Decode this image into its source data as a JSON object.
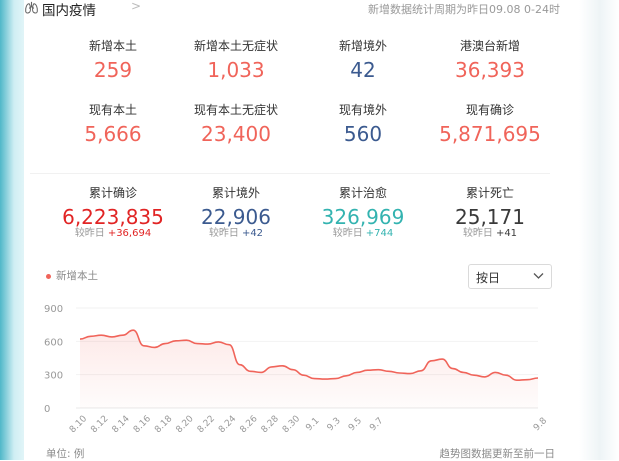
{
  "header": {
    "title": "国内疫情",
    "chevron": ">",
    "period_note": "新增数据统计周期为昨日09.08 0-24时",
    "icon": "lungs-icon"
  },
  "colors": {
    "red": "#f0645a",
    "blue": "#3b5a8f",
    "dark_red": "#e12424",
    "teal": "#33b3b0",
    "dark": "#3a3a3a"
  },
  "stats_row1": [
    {
      "label": "新增本土",
      "value": "259"
    },
    {
      "label": "新增本土无症状",
      "value": "1,033"
    },
    {
      "label": "新增境外",
      "value": "42"
    },
    {
      "label": "港澳台新增",
      "value": "36,393"
    }
  ],
  "stats_row2": [
    {
      "label": "现有本土",
      "value": "5,666"
    },
    {
      "label": "现有本土无症状",
      "value": "23,400"
    },
    {
      "label": "现有境外",
      "value": "560"
    },
    {
      "label": "现有确诊",
      "value": "5,871,695"
    }
  ],
  "stats_row3": [
    {
      "label": "累计确诊",
      "value": "6,223,835",
      "sub_prefix": "较昨日",
      "delta": "+36,694"
    },
    {
      "label": "累计境外",
      "value": "22,906",
      "sub_prefix": "较昨日",
      "delta": "+42"
    },
    {
      "label": "累计治愈",
      "value": "326,969",
      "sub_prefix": "较昨日",
      "delta": "+744"
    },
    {
      "label": "累计死亡",
      "value": "25,171",
      "sub_prefix": "较昨日",
      "delta": "+41"
    }
  ],
  "chart_controls": {
    "legend": "新增本土",
    "range_select": "按日"
  },
  "chart_data": {
    "type": "area",
    "series": [
      {
        "name": "新增本土",
        "values": [
          620,
          645,
          655,
          640,
          655,
          700,
          560,
          545,
          580,
          605,
          610,
          580,
          575,
          595,
          570,
          390,
          330,
          320,
          370,
          380,
          345,
          295,
          265,
          260,
          265,
          290,
          320,
          340,
          345,
          330,
          315,
          310,
          335,
          425,
          440,
          355,
          320,
          295,
          280,
          320,
          295,
          250,
          255,
          270
        ]
      }
    ],
    "x_tick_labels": [
      "8.10",
      "8.12",
      "8.14",
      "8.16",
      "8.18",
      "8.20",
      "8.22",
      "8.24",
      "8.26",
      "8.28",
      "8.30",
      "9.1",
      "9.3",
      "9.5",
      "9.7",
      "9.8"
    ],
    "y_ticks": [
      0,
      300,
      600,
      900
    ],
    "ylim": [
      0,
      900
    ],
    "grid": true,
    "line_color": "#f0645a"
  },
  "footer": {
    "unit": "单位: 例",
    "note": "趋势图数据更新至前一日"
  }
}
